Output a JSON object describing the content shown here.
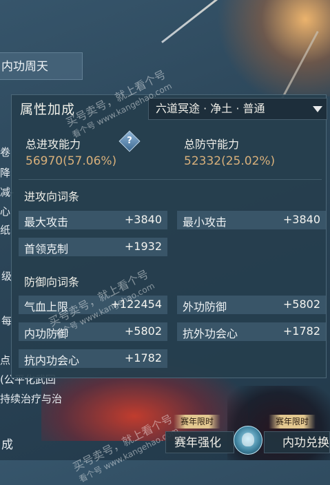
{
  "left_tab": "内功周天",
  "side_fragments": [
    "卷",
    "降",
    "减-",
    "心",
    "纸",
    "级",
    "每",
    "点",
    "(公平化武回",
    "持续治疗与治"
  ],
  "bottom_left_label": "成",
  "panel": {
    "title": "属性加成",
    "dropdown": "六道冥途 · 净土 · 普通",
    "attack_power": {
      "label": "总进攻能力",
      "value": "56970(57.06%)"
    },
    "defense_power": {
      "label": "总防守能力",
      "value": "52332(25.02%)"
    },
    "help_icon": "?",
    "attack_section": {
      "title": "进攻向词条",
      "rows": [
        {
          "label": "最大攻击",
          "value": "+3840"
        },
        {
          "label": "最小攻击",
          "value": "+3840"
        },
        {
          "label": "首领克制",
          "value": "+1932"
        }
      ]
    },
    "defense_section": {
      "title": "防御向词条",
      "rows": [
        {
          "label": "气血上限",
          "value": "+122454"
        },
        {
          "label": "外功防御",
          "value": "+5802"
        },
        {
          "label": "内功防御",
          "value": "+5802"
        },
        {
          "label": "抗外功会心",
          "value": "+1782"
        },
        {
          "label": "抗内功会心",
          "value": "+1782"
        }
      ]
    }
  },
  "watermarks": [
    {
      "big": "买号卖号，就上看个号",
      "small": "看个号 www.kangehao.com"
    },
    {
      "big": "买号卖号，就上看个号",
      "small": "看个号 www.kangehao.com"
    },
    {
      "big": "买号卖号，就上看个号",
      "small": "看个号 www.kangehao.com"
    }
  ],
  "bottom": {
    "badge_left": "赛年限时",
    "badge_right": "赛年限时",
    "button_left": "赛年强化",
    "button_right": "内功兑换"
  }
}
